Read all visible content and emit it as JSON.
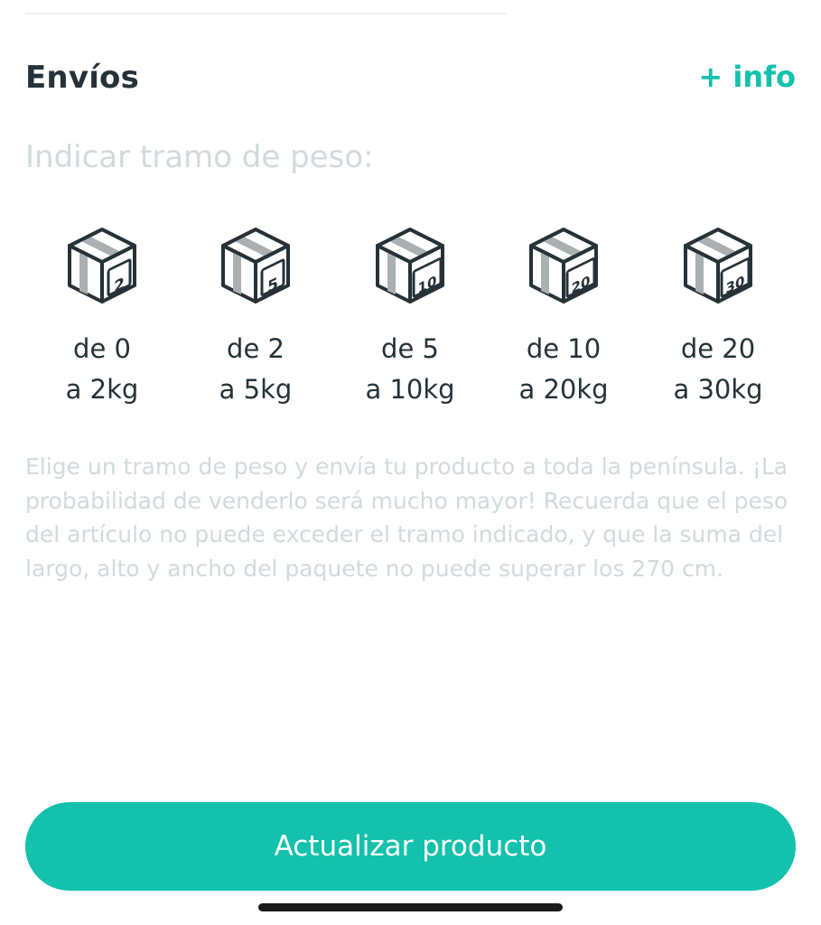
{
  "shipping": {
    "title": "Envíos",
    "info_link": "+ info",
    "weight_prompt": "Indicar tramo de peso:",
    "options": [
      {
        "icon": "box-2kg-icon",
        "badge": "2",
        "line1": "de 0",
        "line2": "a 2kg"
      },
      {
        "icon": "box-5kg-icon",
        "badge": "5",
        "line1": "de 2",
        "line2": "a 5kg"
      },
      {
        "icon": "box-10kg-icon",
        "badge": "10",
        "line1": "de 5",
        "line2": "a 10kg"
      },
      {
        "icon": "box-20kg-icon",
        "badge": "20",
        "line1": "de 10",
        "line2": "a 20kg"
      },
      {
        "icon": "box-30kg-icon",
        "badge": "30",
        "line1": "de 20",
        "line2": "a 30kg"
      }
    ],
    "help_text": "Elige un tramo de peso y envía tu producto a toda la península. ¡La probabilidad de venderlo será mucho mayor! Recuerda que el peso del artículo no puede exceder el tramo indicado, y que la suma del largo, alto y ancho del paquete no puede superar los 270 cm."
  },
  "actions": {
    "update_label": "Actualizar producto"
  },
  "colors": {
    "accent": "#13c1ac",
    "text_primary": "#253238",
    "text_muted": "#d3dadd"
  }
}
